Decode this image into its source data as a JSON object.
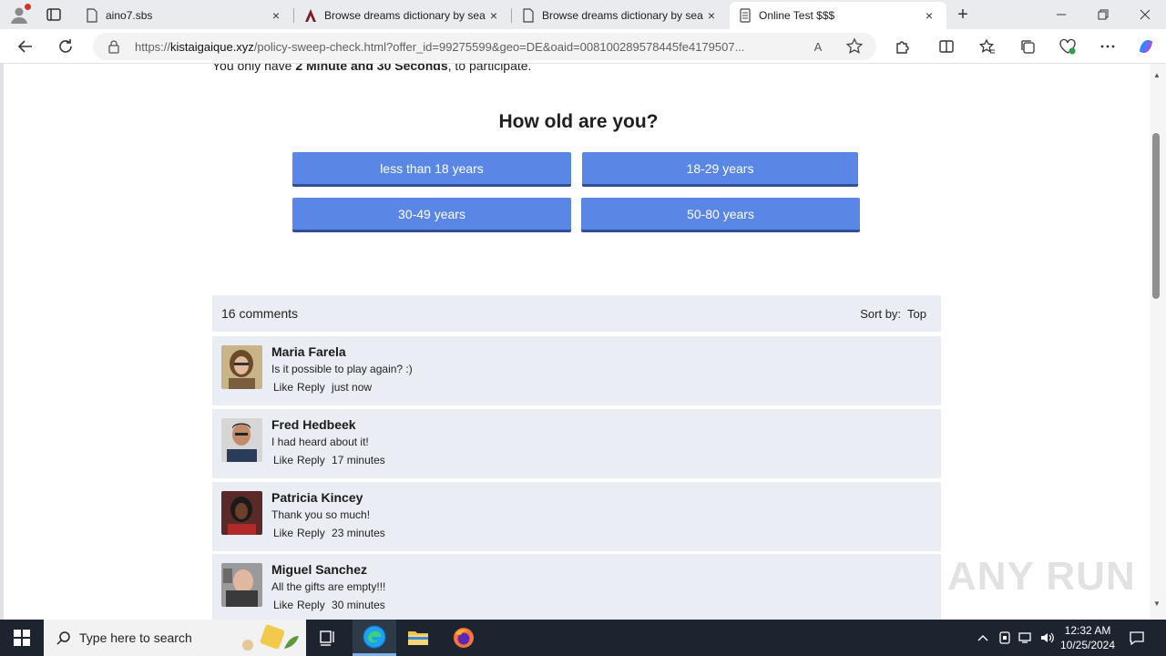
{
  "browser": {
    "tabs": [
      {
        "title": "aino7.sbs",
        "close": "×"
      },
      {
        "title": "Browse dreams dictionary by search",
        "close": "×"
      },
      {
        "title": "Browse dreams dictionary by search",
        "close": "×"
      },
      {
        "title": "Online Test $$$",
        "close": "×",
        "active": true
      }
    ],
    "new_tab": "+",
    "url_prefix": "https://",
    "url_domain": "kistaigaique.xyz",
    "url_rest": "/policy-sweep-check.html?offer_id=99275599&geo=DE&oaid=008100289578445fe4179507...",
    "read_aloud": "A"
  },
  "page": {
    "notice_pre": "You only have ",
    "notice_bold": "2 Minute and 30 Seconds",
    "notice_post": ", to participate.",
    "question": "How old are you?",
    "answers": [
      "less than 18 years",
      "18-29 years",
      "30-49 years",
      "50-80 years"
    ],
    "accent_color": "#5a86e6",
    "comments_header": {
      "count": "16 comments",
      "sort_label": "Sort by:",
      "sort_value": "Top"
    },
    "comments": [
      {
        "name": "Maria Farela",
        "text": "Is it possible to play again? :)",
        "like": "Like",
        "reply": "Reply",
        "time": "just now"
      },
      {
        "name": "Fred Hedbeek",
        "text": "I had heard about it!",
        "like": "Like",
        "reply": "Reply",
        "time": "17 minutes"
      },
      {
        "name": "Patricia Kincey",
        "text": "Thank you so much!",
        "like": "Like",
        "reply": "Reply",
        "time": "23 minutes"
      },
      {
        "name": "Miguel Sanchez",
        "text": "All the gifts are empty!!!",
        "like": "Like",
        "reply": "Reply",
        "time": "30 minutes"
      }
    ],
    "watermark": "ANY RUN"
  },
  "taskbar": {
    "search_placeholder": "Type here to search",
    "time": "12:32 AM",
    "date": "10/25/2024"
  }
}
